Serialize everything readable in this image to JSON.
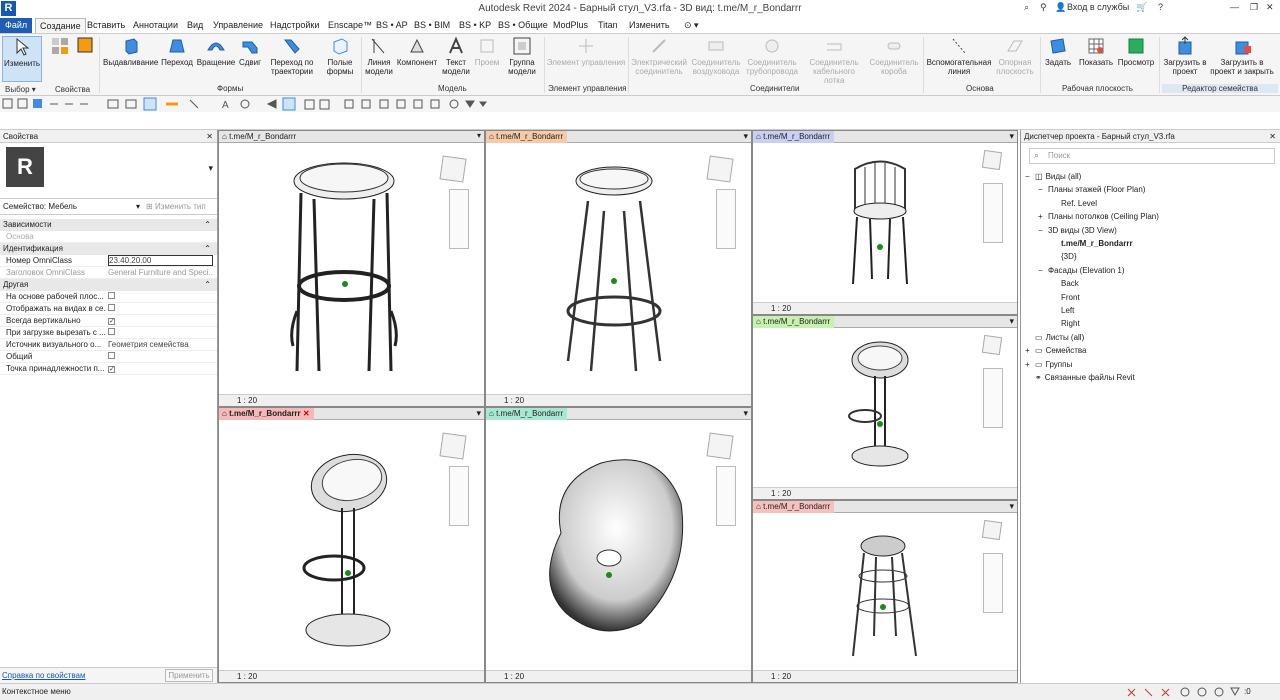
{
  "app": {
    "title": "Autodesk Revit 2024 - Барный стул_V3.rfa - 3D вид: t.me/M_r_Bondarrr",
    "login": "Вход в службы"
  },
  "menu": [
    "Файл",
    "Создание",
    "Вставить",
    "Аннотации",
    "Вид",
    "Управление",
    "Надстройки",
    "Enscape™",
    "BS • AP",
    "BS • BIM",
    "BS • KP",
    "BS • Общие",
    "ModPlus",
    "Titan",
    "Изменить"
  ],
  "ribbon": {
    "modify": "Изменить",
    "select": "Выбор",
    "properties": "Свойства",
    "extrude": "Выдавливание",
    "blend": "Переход",
    "revolve": "Вращение",
    "sweep": "Сдвиг",
    "swept_blend": "Переход по траектории",
    "void": "Полые формы",
    "forms_group": "Формы",
    "model_line": "Линия модели",
    "component": "Компонент",
    "model_text": "Текст модели",
    "opening": "Проем",
    "model_group": "Группа модели",
    "model_group_label": "Модель",
    "control": "Элемент управления",
    "control_group": "Элемент управления",
    "conn_elec": "Электрический соединитель",
    "conn_duct": "Соединитель воздуховода",
    "conn_pipe": "Соединитель трубопровода",
    "conn_tray": "Соединитель кабельного лотка",
    "conn_conduit": "Соединитель короба",
    "conn_group": "Соединители",
    "ref_line": "Вспомогательная линия",
    "ref_plane": "Опорная плоскость",
    "datum_group": "Основа",
    "set": "Задать",
    "show": "Показать",
    "viewer": "Просмотр",
    "wp_group": "Рабочая плоскость",
    "load_project": "Загрузить в проект",
    "load_close": "Загрузить в проект и закрыть",
    "editor_group": "Редактор семейства"
  },
  "properties": {
    "title": "Свойства",
    "family": "Семейство: Мебель",
    "edit_type": "Изменить тип",
    "sec_constraints": "Зависимости",
    "host": "Основа",
    "sec_ident": "Идентификация",
    "omni_num": "Номер OmniClass",
    "omni_num_val": "23.40.20.00",
    "omni_title": "Заголовок OmniClass",
    "omni_title_val": "General Furniture and Speci...",
    "sec_other": "Другая",
    "rows": [
      {
        "k": "На основе рабочей плос...",
        "v": false
      },
      {
        "k": "Отображать на видах в се...",
        "v": false
      },
      {
        "k": "Всегда вертикально",
        "v": true
      },
      {
        "k": "При загрузке вырезать с ...",
        "v": false
      },
      {
        "k": "Источник визуального о...",
        "v": "Геометрия семейства"
      },
      {
        "k": "Общий",
        "v": false
      },
      {
        "k": "Точка принадлежности п...",
        "v": true
      }
    ],
    "help": "Справка по свойствам",
    "apply": "Применить"
  },
  "views": {
    "tab": "t.me/M_r_Bondarrr",
    "scale": "1 : 20"
  },
  "browser": {
    "title": "Диспетчер проекта - Барный стул_V3.rfa",
    "search": "Поиск",
    "items": [
      {
        "t": "Виды (all)",
        "lvl": 0,
        "sign": "−"
      },
      {
        "t": "Планы этажей (Floor Plan)",
        "lvl": 1,
        "sign": "−"
      },
      {
        "t": "Ref. Level",
        "lvl": 2,
        "sign": ""
      },
      {
        "t": "Планы потолков (Ceiling Plan)",
        "lvl": 1,
        "sign": "+"
      },
      {
        "t": "3D виды (3D View)",
        "lvl": 1,
        "sign": "−"
      },
      {
        "t": "t.me/M_r_Bondarrr",
        "lvl": 2,
        "sign": "",
        "bold": true
      },
      {
        "t": "{3D}",
        "lvl": 2,
        "sign": ""
      },
      {
        "t": "Фасады (Elevation 1)",
        "lvl": 1,
        "sign": "−"
      },
      {
        "t": "Back",
        "lvl": 2,
        "sign": ""
      },
      {
        "t": "Front",
        "lvl": 2,
        "sign": ""
      },
      {
        "t": "Left",
        "lvl": 2,
        "sign": ""
      },
      {
        "t": "Right",
        "lvl": 2,
        "sign": ""
      },
      {
        "t": "Листы (all)",
        "lvl": 0,
        "sign": ""
      },
      {
        "t": "Семейства",
        "lvl": 0,
        "sign": "+"
      },
      {
        "t": "Группы",
        "lvl": 0,
        "sign": "+"
      },
      {
        "t": "Связанные файлы Revit",
        "lvl": 0,
        "sign": ""
      }
    ]
  },
  "status": {
    "text": "Контекстное меню",
    "filter": ":0"
  }
}
